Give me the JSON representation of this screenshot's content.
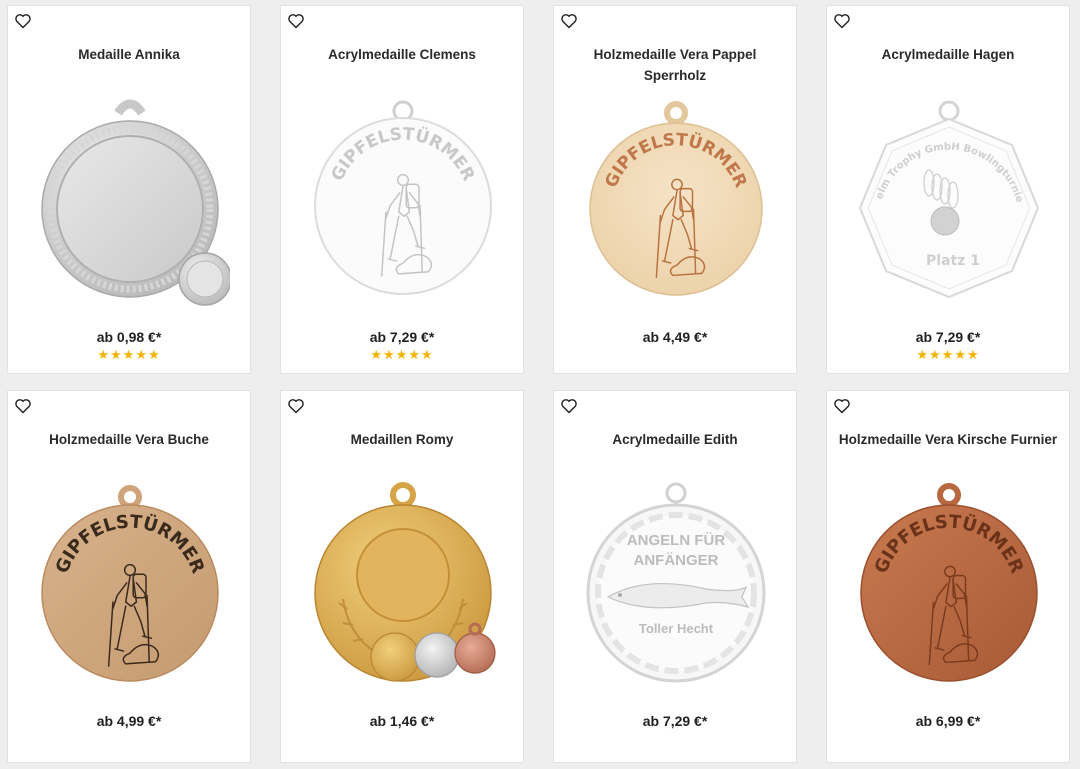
{
  "products": [
    {
      "name": "Medaille Annika",
      "price": "ab 0,98 €*",
      "rating": "★★★★★",
      "image": "silver-medal"
    },
    {
      "name": "Acrylmedaille Clemens",
      "price": "ab 7,29 €*",
      "rating": "★★★★★",
      "image": "acrylic-round-hiker",
      "engraving": "GIPFELSTÜRMER"
    },
    {
      "name": "Holzmedaille Vera Pappel Sperrholz",
      "price": "ab 4,49 €*",
      "image": "poplar-wood-hiker",
      "engraving": "GIPFELSTÜRMER"
    },
    {
      "name": "Acrylmedaille Hagen",
      "price": "ab 7,29 €*",
      "rating": "★★★★★",
      "image": "acrylic-octagon-bowling",
      "engraving_top": "Helm Trophy GmbH Bowlingturnier",
      "engraving_bottom": "Platz 1"
    },
    {
      "name": "Holzmedaille Vera Buche",
      "price": "ab 4,99 €*",
      "image": "beech-wood-hiker",
      "engraving": "GIPFELSTÜRMER"
    },
    {
      "name": "Medaillen Romy",
      "price": "ab 1,46 €*",
      "image": "gold-medal-wreath"
    },
    {
      "name": "Acrylmedaille Edith",
      "price": "ab 7,29 €*",
      "image": "acrylic-fish",
      "engraving_top": "ANGELN FÜR",
      "engraving_mid": "ANFÄNGER",
      "engraving_bottom": "Toller Hecht"
    },
    {
      "name": "Holzmedaille Vera Kirsche Furnier",
      "price": "ab 6,99 €*",
      "image": "cherry-wood-hiker",
      "engraving": "GIPFELSTÜRMER"
    }
  ],
  "colors": {
    "star": "#f5b301",
    "card_bg": "#ffffff",
    "page_bg": "#eeeeee"
  }
}
